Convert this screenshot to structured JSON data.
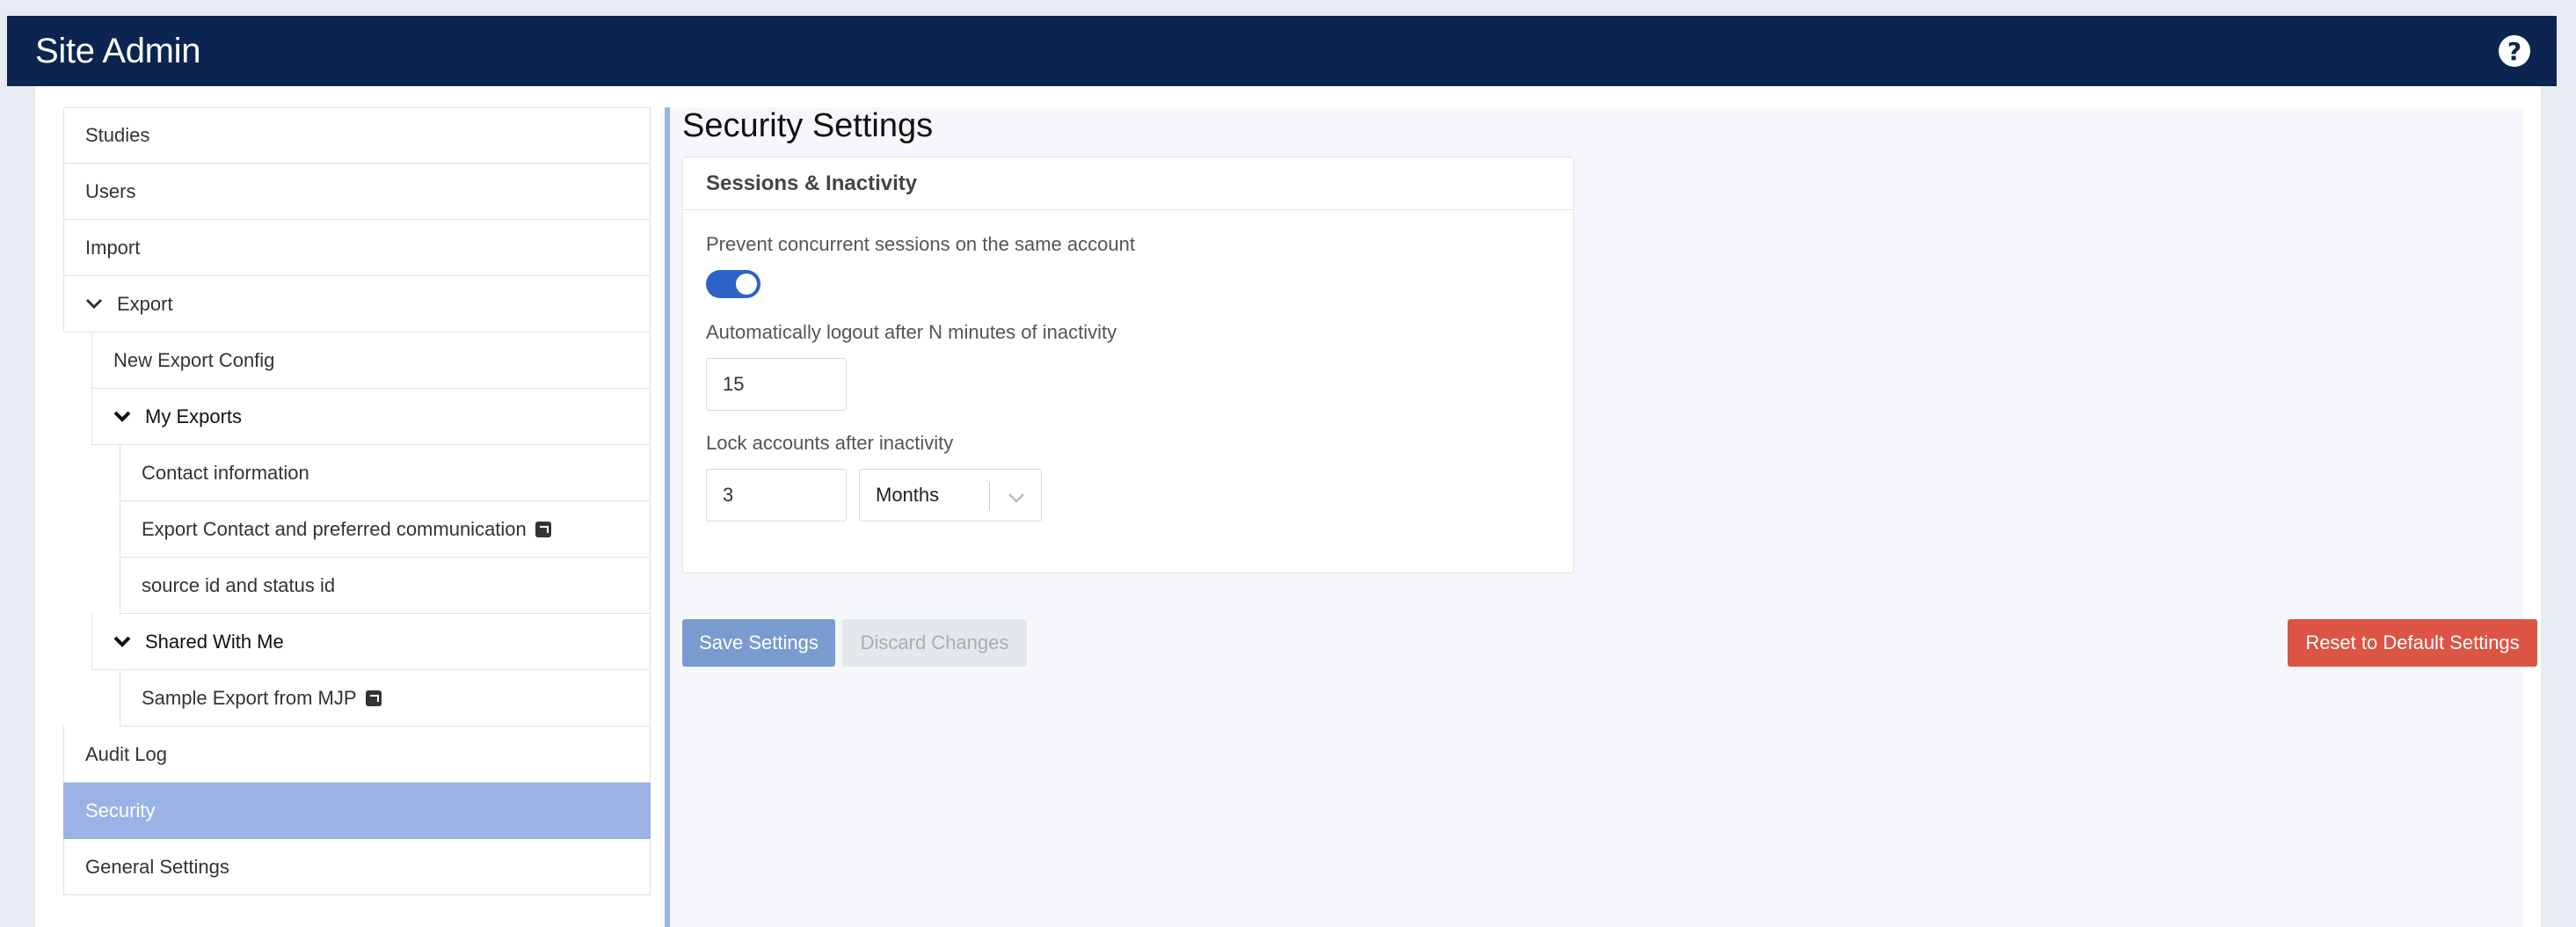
{
  "header": {
    "title": "Site Admin",
    "help_icon": "question-circle-icon"
  },
  "sidebar": {
    "items": [
      {
        "label": "Studies"
      },
      {
        "label": "Users"
      },
      {
        "label": "Import"
      },
      {
        "label": "Export"
      },
      {
        "label": "New Export Config"
      },
      {
        "label": "My Exports"
      },
      {
        "label": "Contact information"
      },
      {
        "label": "Export Contact and preferred communication"
      },
      {
        "label": "source id and status id"
      },
      {
        "label": "Shared With Me"
      },
      {
        "label": "Sample Export from MJP"
      },
      {
        "label": "Audit Log"
      },
      {
        "label": "Security"
      },
      {
        "label": "General Settings"
      }
    ]
  },
  "main": {
    "title": "Security Settings",
    "card": {
      "title": "Sessions & Inactivity",
      "concurrent_label": "Prevent concurrent sessions on the same account",
      "concurrent_enabled": true,
      "logout_label": "Automatically logout after N minutes of inactivity",
      "logout_value": "15",
      "lock_label": "Lock accounts after inactivity",
      "lock_value": "3",
      "lock_unit": "Months"
    },
    "buttons": {
      "save": "Save Settings",
      "discard": "Discard Changes",
      "reset": "Reset to Default Settings"
    }
  },
  "colors": {
    "header_bg": "#0b2550",
    "active_nav": "#9ab2e6",
    "toggle_on": "#2d63c8",
    "save_btn": "#7a9bcf",
    "reset_btn": "#dc5443"
  }
}
